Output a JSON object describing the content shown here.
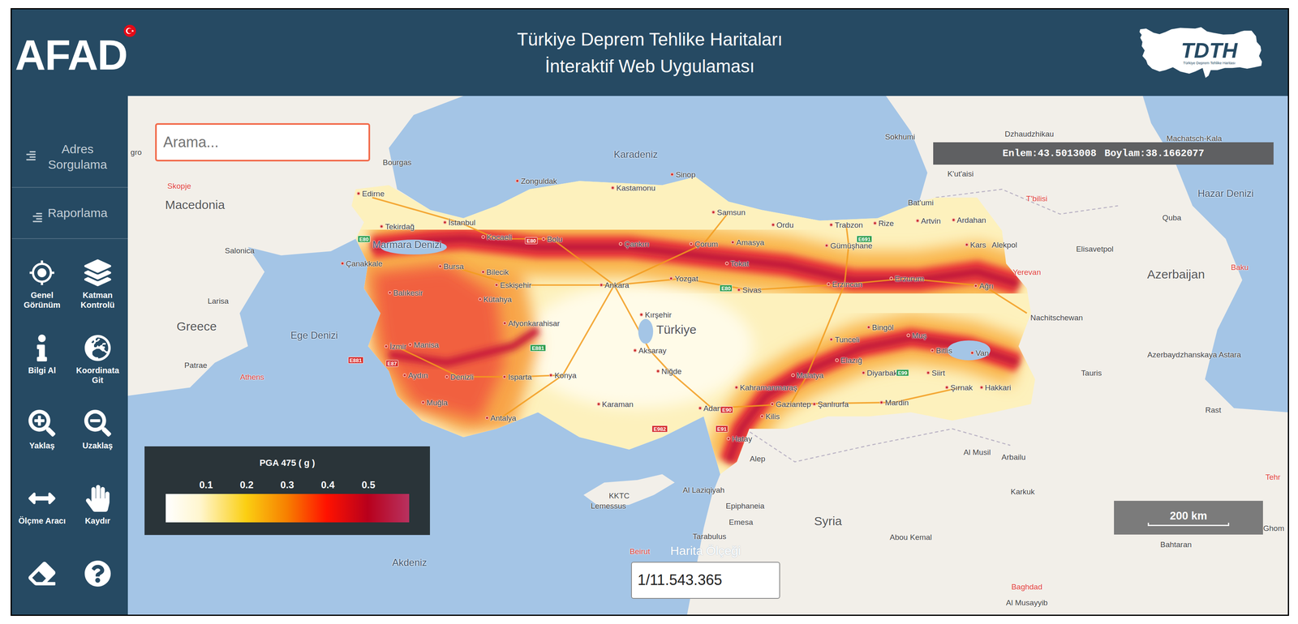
{
  "header": {
    "logo": "AFAD",
    "title": [
      "Türkiye Deprem Tehlike Haritaları",
      "İnteraktif Web Uygulaması"
    ],
    "badge": {
      "title": "TDTH",
      "subtitle": "Türkiye Deprem Tehlike Haritası"
    }
  },
  "sidebar": {
    "menus": [
      {
        "label": "Adres Sorgulama"
      },
      {
        "label": "Raporlama"
      }
    ],
    "tools": [
      {
        "label": "Genel Görünüm"
      },
      {
        "label": "Katman Kontrolü"
      },
      {
        "label": "Bilgi Al"
      },
      {
        "label": "Koordinata Git"
      },
      {
        "label": "Yaklaş"
      },
      {
        "label": "Uzaklaş"
      },
      {
        "label": "Ölçme Aracı"
      },
      {
        "label": "Kaydır"
      }
    ]
  },
  "search": {
    "placeholder": "Arama..."
  },
  "coordinates": {
    "lat_label": "Enlem:",
    "lat": "43.5013008",
    "lon_label": "Boylam:",
    "lon": "38.1662077"
  },
  "legend": {
    "title": "PGA 475 ( g )",
    "ticks": [
      "0.1",
      "0.2",
      "0.3",
      "0.4",
      "0.5"
    ]
  },
  "scale_bar": {
    "label": "200 km"
  },
  "map_scale": {
    "label": "Harita Ölçeği",
    "value": "1/11.543.365"
  },
  "map_labels": [
    {
      "label": "gro",
      "kind": "place"
    },
    {
      "label": "Bourgas",
      "kind": "place"
    },
    {
      "label": "Karadeniz",
      "kind": "sea"
    },
    {
      "label": "Sokhumi",
      "kind": "place"
    },
    {
      "label": "Dzhaudzhikau",
      "kind": "place"
    },
    {
      "label": "Machatsch-Kala",
      "kind": "place"
    },
    {
      "label": "K'ut'aisi",
      "kind": "place"
    },
    {
      "label": "Sinop",
      "kind": "city"
    },
    {
      "label": "Skopje",
      "kind": "capital"
    },
    {
      "label": "Macedonia",
      "kind": "country"
    },
    {
      "label": "Edirne",
      "kind": "city"
    },
    {
      "label": "Zonguldak",
      "kind": "city"
    },
    {
      "label": "Kastamonu",
      "kind": "city"
    },
    {
      "label": "Samsun",
      "kind": "city"
    },
    {
      "label": "Bat'umi",
      "kind": "place"
    },
    {
      "label": "T'bilisi",
      "kind": "capital"
    },
    {
      "label": "Hazar Denizi",
      "kind": "sea"
    },
    {
      "label": "Ordu",
      "kind": "city"
    },
    {
      "label": "Trabzon",
      "kind": "city"
    },
    {
      "label": "Rize",
      "kind": "city"
    },
    {
      "label": "Artvin",
      "kind": "city"
    },
    {
      "label": "Ardahan",
      "kind": "city"
    },
    {
      "label": "Quba",
      "kind": "place"
    },
    {
      "label": "Tekirdağ",
      "kind": "city"
    },
    {
      "label": "İstanbul",
      "kind": "city"
    },
    {
      "label": "Marmara Denizi",
      "kind": "sea"
    },
    {
      "label": "Kocaeli",
      "kind": "city"
    },
    {
      "label": "Bolu",
      "kind": "city"
    },
    {
      "label": "Çankırı",
      "kind": "city"
    },
    {
      "label": "Çorum",
      "kind": "city"
    },
    {
      "label": "Amasya",
      "kind": "city"
    },
    {
      "label": "Gümüşhane",
      "kind": "city"
    },
    {
      "label": "Kars",
      "kind": "city"
    },
    {
      "label": "Alekpol",
      "kind": "place"
    },
    {
      "label": "Salonica",
      "kind": "place"
    },
    {
      "label": "Elisavetpol",
      "kind": "place"
    },
    {
      "label": "Çanakkale",
      "kind": "city"
    },
    {
      "label": "Bursa",
      "kind": "city"
    },
    {
      "label": "Bilecik",
      "kind": "city"
    },
    {
      "label": "Tokat",
      "kind": "city"
    },
    {
      "label": "Yerevan",
      "kind": "capital"
    },
    {
      "label": "Baku",
      "kind": "capital"
    },
    {
      "label": "Azerbaijan",
      "kind": "country"
    },
    {
      "label": "Eskişehir",
      "kind": "city"
    },
    {
      "label": "Ankara",
      "kind": "city"
    },
    {
      "label": "Yozgat",
      "kind": "city"
    },
    {
      "label": "Sivas",
      "kind": "city"
    },
    {
      "label": "Erzincan",
      "kind": "city"
    },
    {
      "label": "Erzurum",
      "kind": "city"
    },
    {
      "label": "Ağrı",
      "kind": "city"
    },
    {
      "label": "Balıkesir",
      "kind": "city"
    },
    {
      "label": "Larisa",
      "kind": "place"
    },
    {
      "label": "Kütahya",
      "kind": "city"
    },
    {
      "label": "Kırşehir",
      "kind": "city"
    },
    {
      "label": "Nachitschewan",
      "kind": "place"
    },
    {
      "label": "Afyonkarahisar",
      "kind": "city"
    },
    {
      "label": "Greece",
      "kind": "country"
    },
    {
      "label": "Ege Denizi",
      "kind": "sea"
    },
    {
      "label": "Türkiye",
      "kind": "country"
    },
    {
      "label": "Bingöl",
      "kind": "city"
    },
    {
      "label": "Muş",
      "kind": "city"
    },
    {
      "label": "Tunceli",
      "kind": "city"
    },
    {
      "label": "İzmir",
      "kind": "city"
    },
    {
      "label": "Manisa",
      "kind": "city"
    },
    {
      "label": "Aksaray",
      "kind": "city"
    },
    {
      "label": "Bitlis",
      "kind": "city"
    },
    {
      "label": "Van",
      "kind": "city"
    },
    {
      "label": "Azerbaydzhanskaya Astara",
      "kind": "place"
    },
    {
      "label": "Elazığ",
      "kind": "city"
    },
    {
      "label": "Patrae",
      "kind": "place"
    },
    {
      "label": "Niğde",
      "kind": "city"
    },
    {
      "label": "Diyarbakır",
      "kind": "city"
    },
    {
      "label": "Siirt",
      "kind": "city"
    },
    {
      "label": "Tauris",
      "kind": "place"
    },
    {
      "label": "Aydın",
      "kind": "city"
    },
    {
      "label": "Denizli",
      "kind": "city"
    },
    {
      "label": "Isparta",
      "kind": "city"
    },
    {
      "label": "Konya",
      "kind": "city"
    },
    {
      "label": "Malatya",
      "kind": "city"
    },
    {
      "label": "Athens",
      "kind": "capital"
    },
    {
      "label": "Kahramanmaraş",
      "kind": "city"
    },
    {
      "label": "Şırnak",
      "kind": "city"
    },
    {
      "label": "Hakkari",
      "kind": "city"
    },
    {
      "label": "Muğla",
      "kind": "city"
    },
    {
      "label": "Karaman",
      "kind": "city"
    },
    {
      "label": "Gaziantep",
      "kind": "city"
    },
    {
      "label": "Şanlıurfa",
      "kind": "city"
    },
    {
      "label": "Mardin",
      "kind": "city"
    },
    {
      "label": "Adana",
      "kind": "city"
    },
    {
      "label": "Rast",
      "kind": "place"
    },
    {
      "label": "Antalya",
      "kind": "city"
    },
    {
      "label": "Kilis",
      "kind": "city"
    },
    {
      "label": "Hatay",
      "kind": "city"
    },
    {
      "label": "Al Musil",
      "kind": "place"
    },
    {
      "label": "Arbailu",
      "kind": "place"
    },
    {
      "label": "Alep",
      "kind": "place"
    },
    {
      "label": "Tehr",
      "kind": "capital"
    },
    {
      "label": "Al Laziqiyah",
      "kind": "place"
    },
    {
      "label": "Karkuk",
      "kind": "place"
    },
    {
      "label": "KKTC",
      "kind": "place"
    },
    {
      "label": "Epiphaneia",
      "kind": "place"
    },
    {
      "label": "Lemessus",
      "kind": "place"
    },
    {
      "label": "Syria",
      "kind": "country"
    },
    {
      "label": "Emesa",
      "kind": "place"
    },
    {
      "label": "Ghom",
      "kind": "place"
    },
    {
      "label": "Tarabulus",
      "kind": "place"
    },
    {
      "label": "Abou Kemal",
      "kind": "place"
    },
    {
      "label": "Bahtaran",
      "kind": "place"
    },
    {
      "label": "Beirut",
      "kind": "capital"
    },
    {
      "label": "Akdeniz",
      "kind": "sea"
    },
    {
      "label": "Baghdad",
      "kind": "capital"
    },
    {
      "label": "Al Musayyib",
      "kind": "place"
    }
  ],
  "road_shields": [
    {
      "label": "E80",
      "color": "#2e9e4f"
    },
    {
      "label": "E80",
      "color": "#d62d2d"
    },
    {
      "label": "E881",
      "color": "#d62d2d"
    },
    {
      "label": "E87",
      "color": "#d62d2d"
    },
    {
      "label": "E881",
      "color": "#2e9e4f"
    },
    {
      "label": "E80",
      "color": "#2e9e4f"
    },
    {
      "label": "E90",
      "color": "#d62d2d"
    },
    {
      "label": "E982",
      "color": "#d62d2d"
    },
    {
      "label": "E91",
      "color": "#d62d2d"
    },
    {
      "label": "E99",
      "color": "#2e9e4f"
    },
    {
      "label": "E691",
      "color": "#2e9e4f"
    }
  ]
}
